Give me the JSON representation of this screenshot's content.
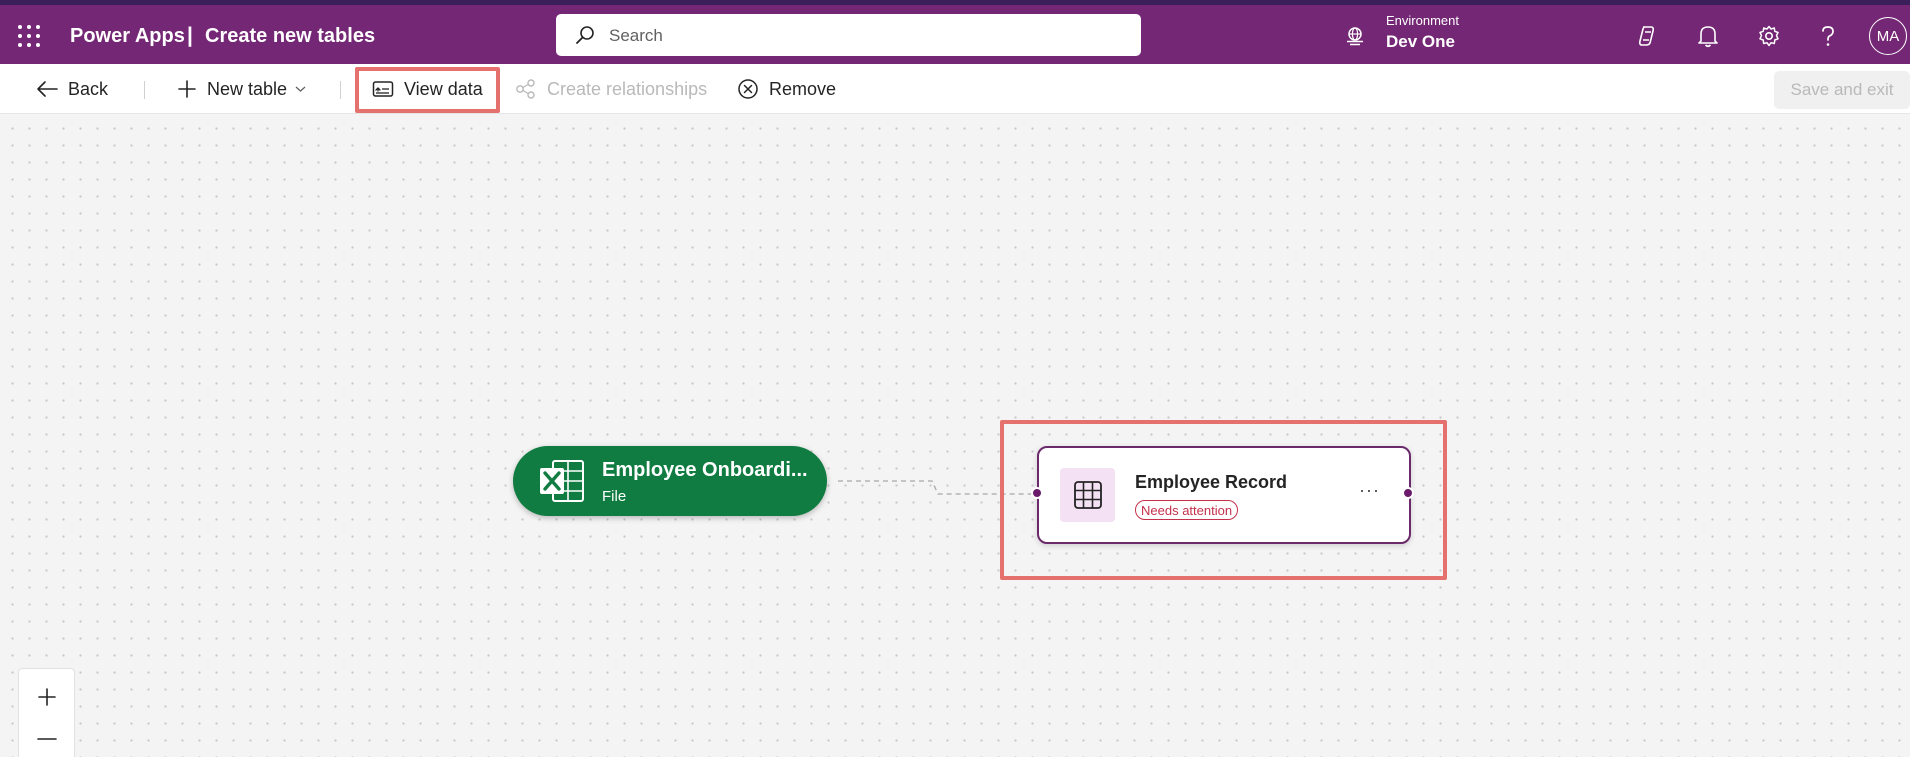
{
  "header": {
    "app_name": "Power Apps",
    "separator": "|",
    "page_title": "Create new tables",
    "search_placeholder": "Search",
    "environment_label": "Environment",
    "environment_value": "Dev One",
    "avatar_initials": "MA",
    "icons": [
      "waffle-icon",
      "search-icon",
      "environment-icon",
      "copilot-icon",
      "bell-icon",
      "gear-icon",
      "help-icon"
    ]
  },
  "commandbar": {
    "back": "Back",
    "new_table": "New table",
    "view_data": "View data",
    "create_relationships": "Create relationships",
    "remove": "Remove",
    "save_and_exit": "Save and exit"
  },
  "canvas": {
    "file_node": {
      "title": "Employee Onboardi...",
      "subtitle": "File",
      "color": "#107c41"
    },
    "table_node": {
      "title": "Employee Record",
      "status": "Needs attention",
      "more": "···",
      "accent": "#6b2a6b"
    },
    "zoom": {
      "in": "+",
      "out": "—"
    }
  },
  "colors": {
    "header_bg": "#742774",
    "highlight": "#e5716f",
    "status_red": "#c4314b"
  }
}
